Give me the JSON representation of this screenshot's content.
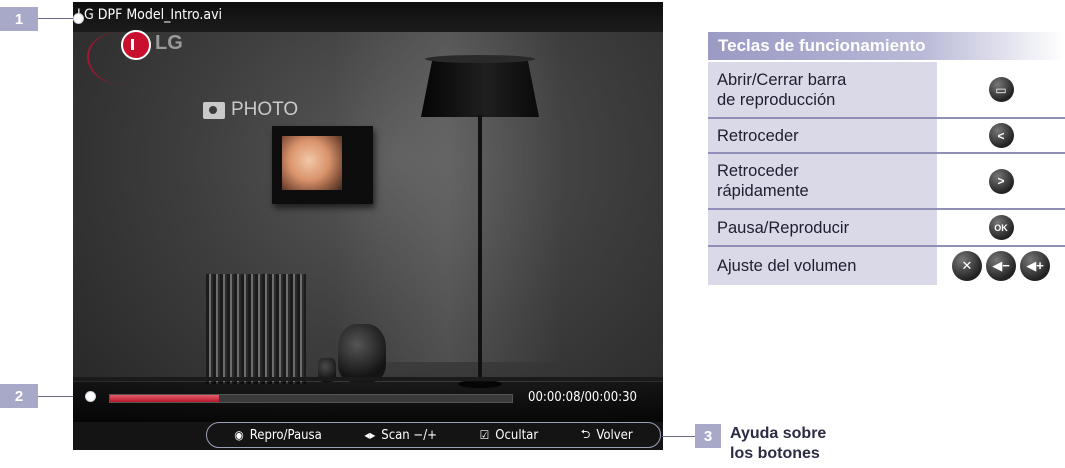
{
  "callouts": [
    {
      "number": "1"
    },
    {
      "number": "2"
    },
    {
      "number": "3",
      "caption_line1": "Ayuda sobre",
      "caption_line2": "los botones"
    }
  ],
  "player": {
    "file_title": "LG DPF Model_Intro.avi",
    "brand": "LG",
    "wall_sign": "PHOTO",
    "progress_fraction": 0.27,
    "time_display": "00:00:08/00:00:30",
    "accent_color": "#c8102e"
  },
  "help_bar": [
    {
      "icon": "ok-circle-icon",
      "glyph": "◉",
      "label": "Repro/Pausa"
    },
    {
      "icon": "left-right-arrows-icon",
      "glyph": "◂▸",
      "label": "Scan −/+"
    },
    {
      "icon": "checkbox-icon",
      "glyph": "☑",
      "label": "Ocultar"
    },
    {
      "icon": "return-icon",
      "glyph": "⮌",
      "label": "Volver"
    }
  ],
  "keys_table": {
    "header": "Teclas de funcionamiento",
    "rows": [
      {
        "line1": "Abrir/Cerrar barra",
        "line2": "de reproducción",
        "icons": [
          {
            "name": "menu-button-icon",
            "glyph": "▭"
          }
        ]
      },
      {
        "line1": "Retroceder",
        "line2": "",
        "icons": [
          {
            "name": "left-button-icon",
            "glyph": "<"
          }
        ]
      },
      {
        "line1": "Retroceder",
        "line2": "rápidamente",
        "icons": [
          {
            "name": "right-button-icon",
            "glyph": ">"
          }
        ]
      },
      {
        "line1": "Pausa/Reproducir",
        "line2": "",
        "icons": [
          {
            "name": "ok-button-icon",
            "glyph": "OK"
          }
        ]
      },
      {
        "line1": "Ajuste del volumen",
        "line2": "",
        "icons": [
          {
            "name": "mute-button-icon",
            "glyph": "✕"
          },
          {
            "name": "volume-down-button-icon",
            "glyph": "◀−"
          },
          {
            "name": "volume-up-button-icon",
            "glyph": "◀+"
          }
        ]
      }
    ]
  }
}
